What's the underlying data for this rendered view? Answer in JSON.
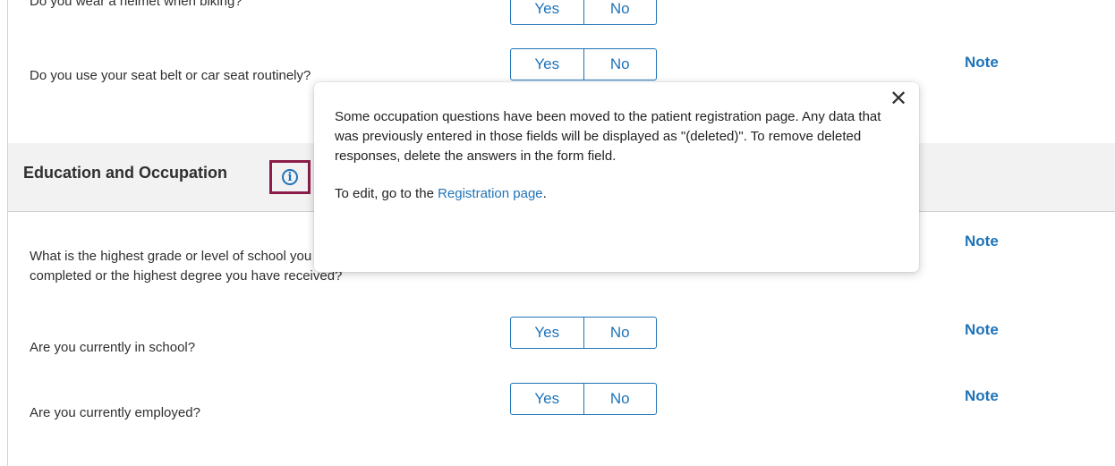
{
  "questions": [
    {
      "text": "Do you wear a helmet when biking?",
      "yes": "Yes",
      "no": "No"
    },
    {
      "text": "Do you use your seat belt or car seat routinely?",
      "yes": "Yes",
      "no": "No",
      "note": "Note"
    }
  ],
  "section": {
    "title": "Education and Occupation",
    "info_icon": "info-icon"
  },
  "education": [
    {
      "text_line1": "What is the highest grade or level of school you have",
      "text_line2": "completed or the highest degree you have received?",
      "note": "Note"
    },
    {
      "text": "Are you currently in school?",
      "yes": "Yes",
      "no": "No",
      "note": "Note"
    },
    {
      "text": "Are you currently employed?",
      "yes": "Yes",
      "no": "No",
      "note": "Note"
    }
  ],
  "popover": {
    "message": "Some occupation questions have been moved to the patient registration page. Any data that was previously entered in those fields will be displayed as \"(deleted)\". To remove deleted responses, delete the answers in the form field.",
    "edit_prefix": "To edit, go to the ",
    "link_text": "Registration page",
    "edit_suffix": ".",
    "close_icon": "close-icon"
  },
  "colors": {
    "accent": "#1f73b7",
    "highlight_border": "#8a1d4a",
    "section_bg": "#f2f2f2"
  }
}
